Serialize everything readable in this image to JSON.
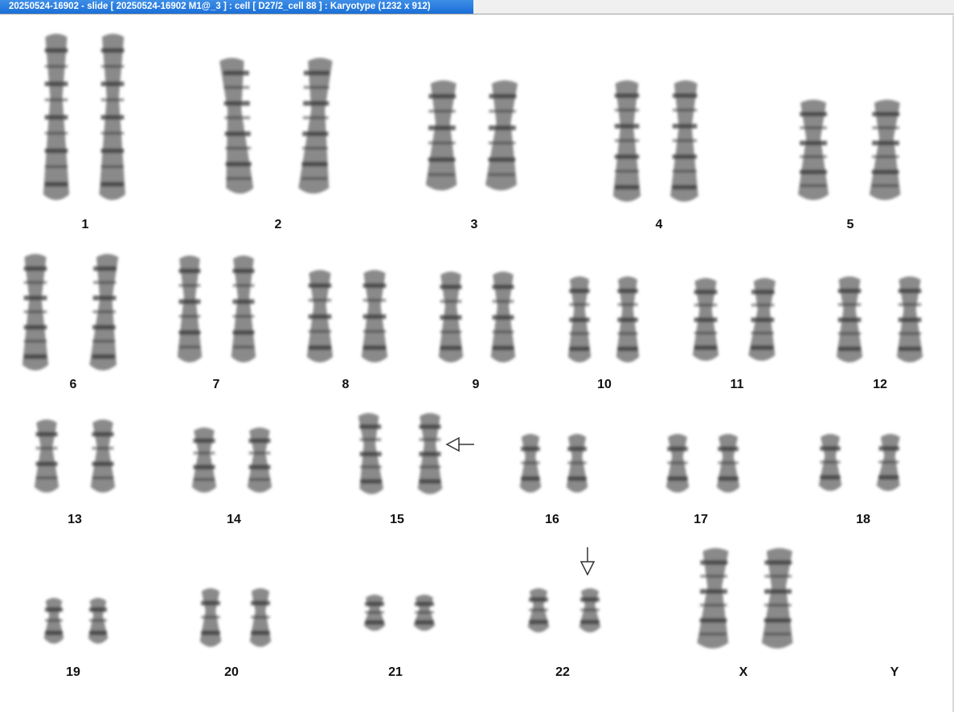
{
  "window": {
    "title": "20250524-16902 - slide [ 20250524-16902 M1@_3 ] : cell [ D27/2_cell 88 ] : Karyotype  (1232 x 912)"
  },
  "karyotype": {
    "labels": {
      "c1": "1",
      "c2": "2",
      "c3": "3",
      "c4": "4",
      "c5": "5",
      "c6": "6",
      "c7": "7",
      "c8": "8",
      "c9": "9",
      "c10": "10",
      "c11": "11",
      "c12": "12",
      "c13": "13",
      "c14": "14",
      "c15": "15",
      "c16": "16",
      "c17": "17",
      "c18": "18",
      "c19": "19",
      "c20": "20",
      "c21": "21",
      "c22": "22",
      "cX": "X",
      "cY": "Y"
    }
  },
  "colors": {
    "title_bar": "#1a6fd8",
    "chromosome_fill": "#8a8a8a",
    "chromosome_band": "#3a3a3a",
    "arrow": "#333333"
  }
}
